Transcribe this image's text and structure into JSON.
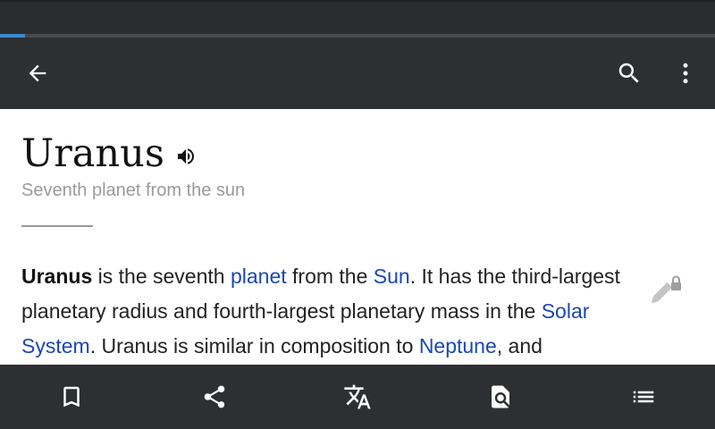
{
  "page_progress": 0.035,
  "toolbar": {
    "back_icon": "arrow-left-icon",
    "search_icon": "search-icon",
    "menu_icon": "more-vert-icon"
  },
  "article": {
    "title": "Uranus",
    "subtitle": "Seventh planet from the sun",
    "audio_icon": "volume-icon",
    "edit_icon": "edit-locked-icon",
    "intro": {
      "bold": "Uranus",
      "t1": " is the seventh ",
      "link1": "planet",
      "t2": " from the ",
      "link2": "Sun",
      "t3": ". It has the third-largest planetary radius and fourth-largest planetary mass in the ",
      "link3": "Solar System",
      "t4": ". Uranus is similar in composition to ",
      "link4": "Neptune",
      "t5": ", and"
    }
  },
  "bottom_bar": {
    "icons": [
      "bookmark-icon",
      "share-icon",
      "translate-icon",
      "find-in-page-icon",
      "contents-list-icon"
    ]
  },
  "colors": {
    "toolbar_bg": "#2e2f33",
    "link": "#1b48b0",
    "progress": "#3b8ad0"
  }
}
